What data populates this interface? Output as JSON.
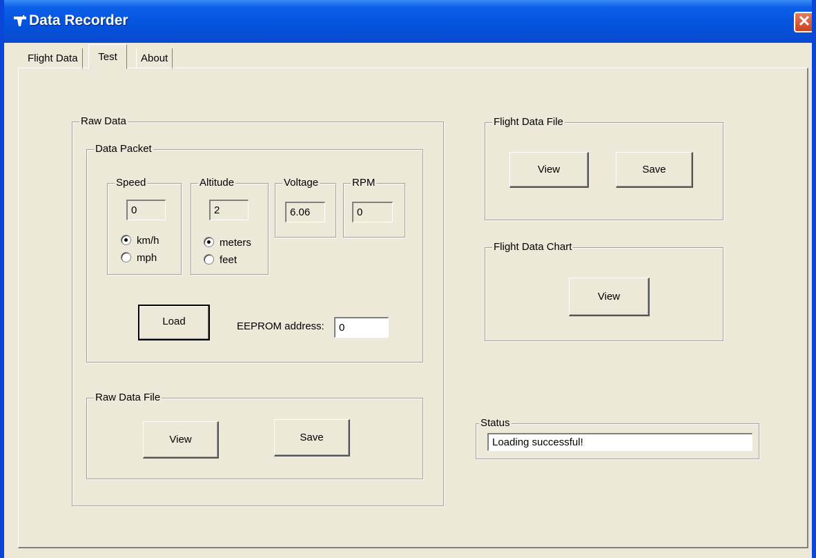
{
  "window": {
    "title": "Data Recorder",
    "close_glyph": "✕"
  },
  "tabs": [
    {
      "label": "Flight Data",
      "active": false
    },
    {
      "label": "Test",
      "active": true
    },
    {
      "label": "About",
      "active": false
    }
  ],
  "raw_data": {
    "label": "Raw Data",
    "data_packet": {
      "label": "Data Packet",
      "speed": {
        "label": "Speed",
        "value": "0",
        "units": [
          "km/h",
          "mph"
        ],
        "selected": "km/h"
      },
      "altitude": {
        "label": "Altitude",
        "value": "2",
        "units": [
          "meters",
          "feet"
        ],
        "selected": "meters"
      },
      "voltage": {
        "label": "Voltage",
        "value": "6.06"
      },
      "rpm": {
        "label": "RPM",
        "value": "0"
      },
      "load_label": "Load",
      "eeprom_label": "EEPROM address:",
      "eeprom_value": "0"
    },
    "raw_data_file": {
      "label": "Raw Data File",
      "view_label": "View",
      "save_label": "Save"
    }
  },
  "flight_data_file": {
    "label": "Flight Data File",
    "view_label": "View",
    "save_label": "Save"
  },
  "flight_data_chart": {
    "label": "Flight Data Chart",
    "view_label": "View"
  },
  "status": {
    "label": "Status",
    "value": "Loading successful!"
  }
}
